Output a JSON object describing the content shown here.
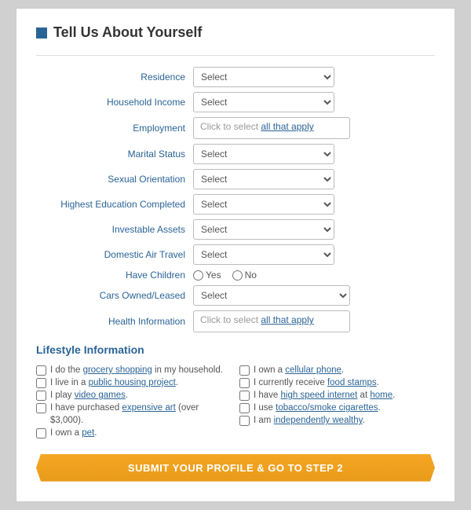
{
  "card": {
    "title": "Tell Us About Yourself",
    "title_icon": "square-icon",
    "fields": [
      {
        "label": "Residence",
        "type": "select",
        "id": "residence"
      },
      {
        "label": "Household Income",
        "type": "select",
        "id": "household_income"
      },
      {
        "label": "Employment",
        "type": "click",
        "id": "employment",
        "placeholder": "Click to select all that apply"
      },
      {
        "label": "Marital Status",
        "type": "select",
        "id": "marital_status"
      },
      {
        "label": "Sexual Orientation",
        "type": "select",
        "id": "sexual_orientation"
      },
      {
        "label": "Highest Education Completed",
        "type": "select",
        "id": "highest_education"
      },
      {
        "label": "Investable Assets",
        "type": "select",
        "id": "investable_assets"
      },
      {
        "label": "Domestic Air Travel",
        "type": "select",
        "id": "domestic_air_travel"
      },
      {
        "label": "Have Children",
        "type": "radio",
        "id": "have_children",
        "options": [
          "Yes",
          "No"
        ]
      },
      {
        "label": "Cars Owned/Leased",
        "type": "select",
        "id": "cars_owned"
      },
      {
        "label": "Health Information",
        "type": "click",
        "id": "health_information",
        "placeholder": "Click to select all that apply"
      }
    ],
    "select_default": "Select",
    "lifestyle": {
      "title": "Lifestyle Information",
      "items_left": [
        {
          "text": "I do the grocery shopping in my household.",
          "highlights": [
            "grocery shopping"
          ]
        },
        {
          "text": "I live in a public housing project.",
          "highlights": [
            "public housing project"
          ]
        },
        {
          "text": "I play video games.",
          "highlights": [
            "video games"
          ]
        },
        {
          "text": "I have purchased expensive art (over $3,000).",
          "highlights": [
            "expensive art"
          ]
        },
        {
          "text": "I own a pet.",
          "highlights": [
            "pet"
          ]
        }
      ],
      "items_right": [
        {
          "text": "I own a cellular phone.",
          "highlights": [
            "cellular phone"
          ]
        },
        {
          "text": "I currently receive food stamps.",
          "highlights": [
            "food stamps"
          ]
        },
        {
          "text": "I have high speed internet at home.",
          "highlights": [
            "high speed internet",
            "home"
          ]
        },
        {
          "text": "I use tobacco/smoke cigarettes.",
          "highlights": [
            "tobacco/smoke cigarettes"
          ]
        },
        {
          "text": "I am independently wealthy.",
          "highlights": [
            "independently wealthy"
          ]
        }
      ]
    },
    "submit_button": "SUBMIT YOUR PROFILE & GO TO STEP 2"
  }
}
